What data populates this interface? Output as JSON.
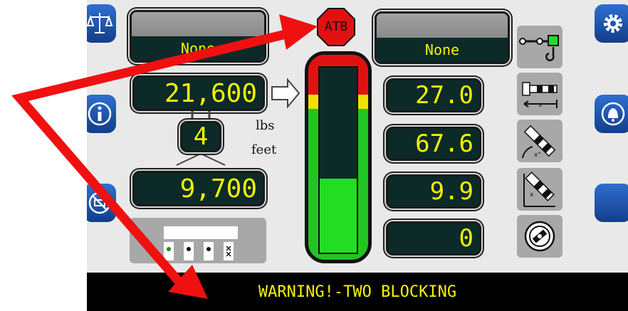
{
  "atb": {
    "label": "ATB"
  },
  "left_boxes": {
    "upper_label": "None"
  },
  "right_boxes": {
    "upper_label": "None"
  },
  "readouts": {
    "load": "21,600",
    "parts_of_line": "4",
    "capacity": "9,700",
    "lbs": "lbs",
    "feet": "feet",
    "radius": "27.0",
    "angle": "67.6",
    "height": "9.9",
    "slew": "0"
  },
  "load_bar": {
    "fill_fraction": 0.4
  },
  "status": {
    "message": "WARNING!-TWO BLOCKING"
  },
  "colors": {
    "accent_yellow": "#f4f400",
    "lcd_bg": "#0c2a28",
    "red": "#e21111",
    "green": "#22dd22",
    "blue_button": "#1f54b0"
  },
  "icons": [
    "scale-icon",
    "info-icon",
    "outrigger-disabled-icon",
    "settings-gear-icon",
    "alarm-bell-icon",
    "anti-two-block-switch-icon",
    "radius-icon",
    "boom-angle-icon",
    "boom-length-icon",
    "swing-icon",
    "outrigger-legs-icon"
  ]
}
